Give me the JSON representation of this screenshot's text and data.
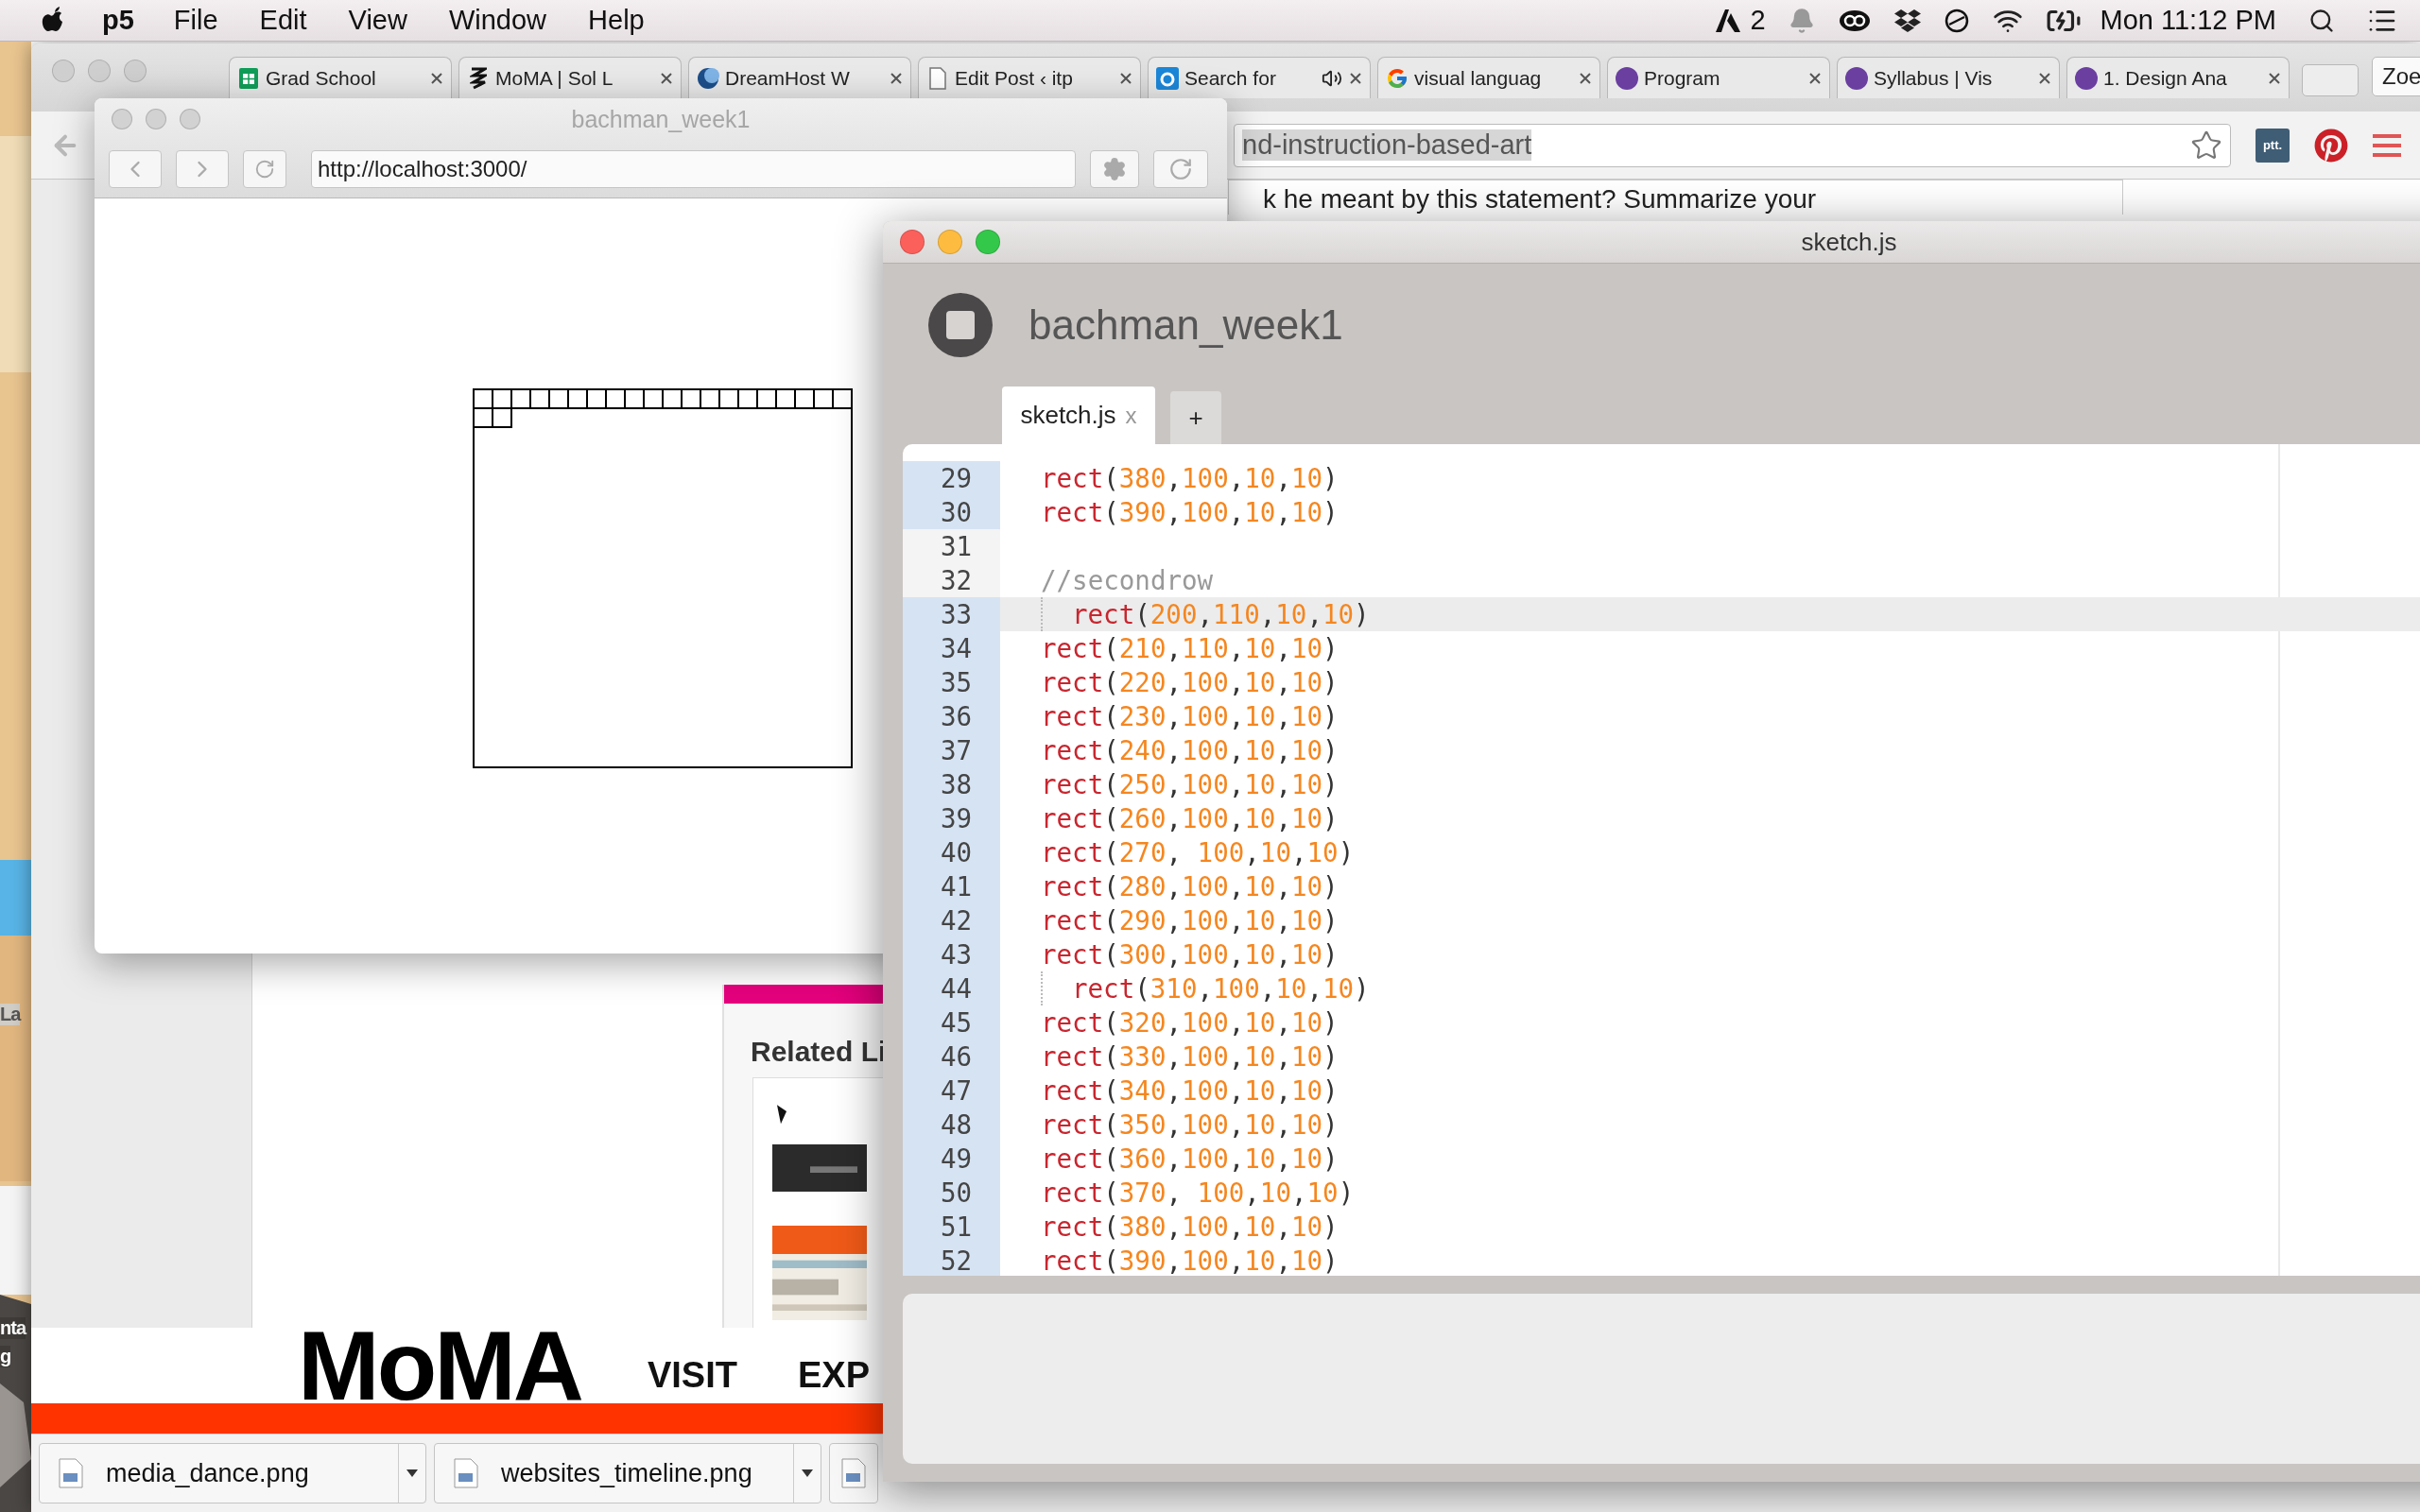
{
  "menu_bar": {
    "app": "p5",
    "menus": [
      "File",
      "Edit",
      "View",
      "Window",
      "Help"
    ],
    "badge_count": "2",
    "clock": "Mon 11:12 PM"
  },
  "desktop_labels": [
    "La",
    "nta",
    "g"
  ],
  "browser": {
    "tabs": [
      {
        "title": "Grad School",
        "kind": "sheet",
        "audio": false
      },
      {
        "title": "MoMA | Sol L",
        "kind": "mark",
        "audio": false
      },
      {
        "title": "DreamHost W",
        "kind": "moon",
        "audio": false
      },
      {
        "title": "Edit Post ‹ itp",
        "kind": "page",
        "audio": false
      },
      {
        "title": "Search for",
        "kind": "square",
        "audio": true
      },
      {
        "title": "visual languag",
        "kind": "g",
        "audio": false
      },
      {
        "title": "Program",
        "kind": "dot",
        "audio": false
      },
      {
        "title": "Syllabus | Vis",
        "kind": "dot",
        "audio": false
      },
      {
        "title": "1. Design Ana",
        "kind": "dot",
        "audio": false
      }
    ],
    "profile": "Zoe",
    "address": "nd-instruction-based-art",
    "address_highlighted": true,
    "extension": "ptt.",
    "page": {
      "text": "k he meant by this statement? Summarize your",
      "sidebar_heading": "Related Li",
      "logo": "MoMA",
      "nav": [
        "VISIT",
        "EXP"
      ]
    },
    "downloads": [
      {
        "kind": "file",
        "name": "media_dance.png"
      },
      {
        "kind": "file",
        "name": "websites_timeline.png"
      },
      {
        "kind": "cut"
      }
    ]
  },
  "preview": {
    "title": "bachman_week1",
    "url": "http://localhost:3000/"
  },
  "editor": {
    "title": "sketch.js",
    "project": "bachman_week1",
    "tabs": [
      {
        "label": "sketch.js",
        "close": "x",
        "selected": true
      }
    ],
    "add_tab": "+",
    "lines": [
      {
        "number": "29",
        "code": "rect(380,100,10,10)",
        "marked": true,
        "indented": false,
        "active": false
      },
      {
        "number": "30",
        "code": "rect(390,100,10,10)",
        "marked": true,
        "indented": false,
        "active": false
      },
      {
        "number": "31",
        "marked": false,
        "indented": false,
        "active": false
      },
      {
        "number": "32",
        "code": "//secondrow",
        "marked": false,
        "indented": false,
        "active": false
      },
      {
        "number": "33",
        "code": "rect(200,110,10,10)",
        "marked": true,
        "indented": true,
        "active": true
      },
      {
        "number": "34",
        "code": "rect(210,110,10,10)",
        "marked": true,
        "indented": false,
        "active": false
      },
      {
        "number": "35",
        "code": "rect(220,100,10,10)",
        "marked": true,
        "indented": false,
        "active": false
      },
      {
        "number": "36",
        "code": "rect(230,100,10,10)",
        "marked": true,
        "indented": false,
        "active": false
      },
      {
        "number": "37",
        "code": "rect(240,100,10,10)",
        "marked": true,
        "indented": false,
        "active": false
      },
      {
        "number": "38",
        "code": "rect(250,100,10,10)",
        "marked": true,
        "indented": false,
        "active": false
      },
      {
        "number": "39",
        "code": "rect(260,100,10,10)",
        "marked": true,
        "indented": false,
        "active": false
      },
      {
        "number": "40",
        "code": "rect(270, 100,10,10)",
        "marked": true,
        "indented": false,
        "active": false
      },
      {
        "number": "41",
        "code": "rect(280,100,10,10)",
        "marked": true,
        "indented": false,
        "active": false
      },
      {
        "number": "42",
        "code": "rect(290,100,10,10)",
        "marked": true,
        "indented": false,
        "active": false
      },
      {
        "number": "43",
        "code": "rect(300,100,10,10)",
        "marked": true,
        "indented": false,
        "active": false
      },
      {
        "number": "44",
        "code": "rect(310,100,10,10)",
        "marked": true,
        "indented": true,
        "active": false
      },
      {
        "number": "45",
        "code": "rect(320,100,10,10)",
        "marked": true,
        "indented": false,
        "active": false
      },
      {
        "number": "46",
        "code": "rect(330,100,10,10)",
        "marked": true,
        "indented": false,
        "active": false
      },
      {
        "number": "47",
        "code": "rect(340,100,10,10)",
        "marked": true,
        "indented": false,
        "active": false
      },
      {
        "number": "48",
        "code": "rect(350,100,10,10)",
        "marked": true,
        "indented": false,
        "active": false
      },
      {
        "number": "49",
        "code": "rect(360,100,10,10)",
        "marked": true,
        "indented": false,
        "active": false
      },
      {
        "number": "50",
        "code": "rect(370, 100,10,10)",
        "marked": true,
        "indented": false,
        "active": false
      },
      {
        "number": "51",
        "code": "rect(380,100,10,10)",
        "marked": true,
        "indented": false,
        "active": false
      },
      {
        "number": "52",
        "code": "rect(390,100,10,10)",
        "marked": true,
        "indented": false,
        "active": false
      }
    ]
  }
}
